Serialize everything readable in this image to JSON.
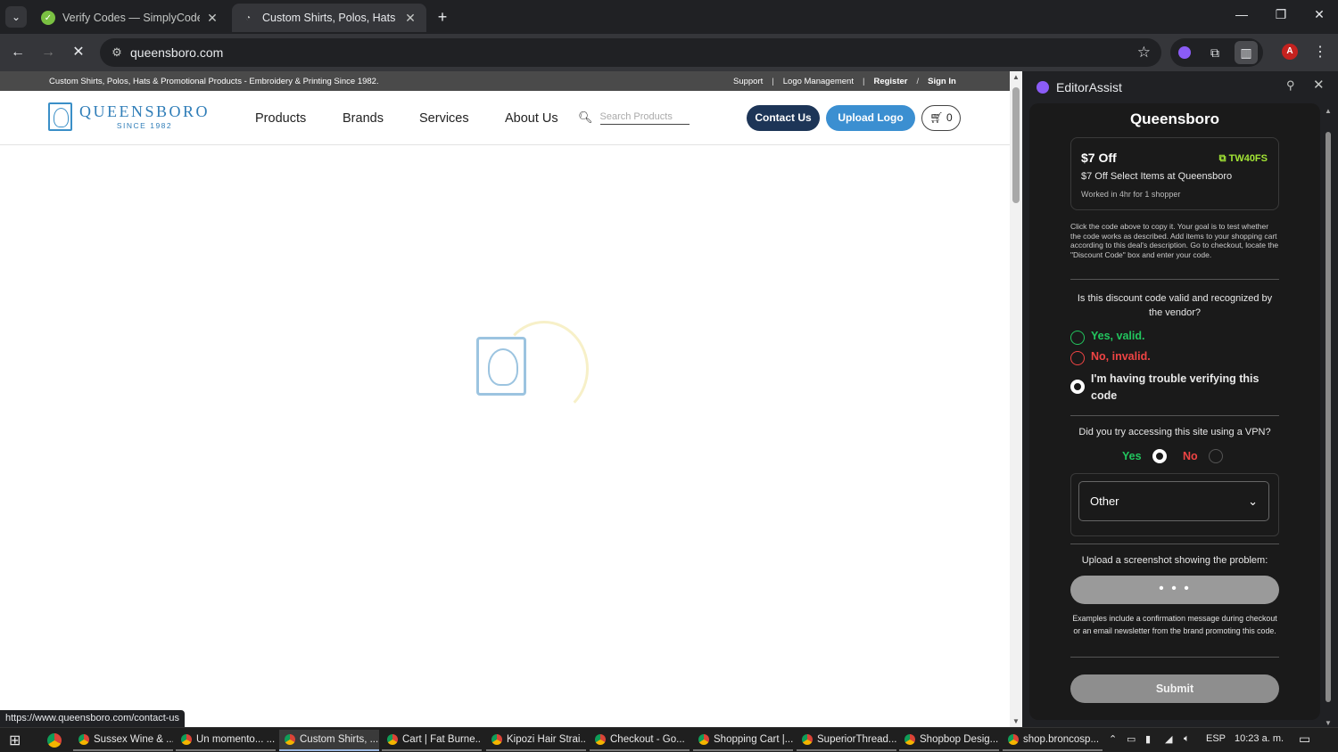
{
  "browser": {
    "tabs": [
      {
        "title": "Verify Codes — SimplyCodes",
        "active": false
      },
      {
        "title": "Custom Shirts, Polos, Hats & Pr",
        "active": true
      }
    ],
    "url": "queensboro.com",
    "status_url": "https://www.queensboro.com/contact-us",
    "profile_initial": "A"
  },
  "site": {
    "tagline": "Custom Shirts, Polos, Hats & Promotional Products - Embroidery & Printing Since 1982.",
    "top_links": [
      "Support",
      "Logo Management",
      "Register",
      "Sign In"
    ],
    "logo": {
      "name": "QUEENSBORO",
      "since": "SINCE 1982"
    },
    "nav": [
      "Products",
      "Brands",
      "Services",
      "About Us"
    ],
    "search_placeholder": "Search Products",
    "contact_label": "Contact Us",
    "upload_label": "Upload Logo",
    "cart_count": "0",
    "colors": {
      "navy": "#1d3557",
      "blue": "#3b8fd1",
      "brand": "#2f7db8"
    }
  },
  "panel": {
    "title": "EditorAssist",
    "store": "Queensboro",
    "deal": {
      "amount": "$7 Off",
      "code": "TW40FS",
      "description": "$7 Off Select Items at Queensboro",
      "worked": "Worked in 4hr for 1 shopper"
    },
    "instructions": "Click the code above to copy it. Your goal is to test whether the code works as described. Add items to your shopping cart according to this deal's description. Go to checkout, locate the \"Discount Code\" box and enter your code.",
    "question_valid": "Is this discount code valid and recognized by the vendor?",
    "options": [
      {
        "label": "Yes, valid.",
        "color": "#22c55e",
        "selected": false
      },
      {
        "label": "No, invalid.",
        "color": "#ef4444",
        "selected": false
      },
      {
        "label": "I'm having trouble verifying this code",
        "color": "#e8e8e8",
        "selected": true
      }
    ],
    "question_vpn": "Did you try accessing this site using a VPN?",
    "vpn_yes": "Yes",
    "vpn_no": "No",
    "vpn_selected": "Yes",
    "reason_select": "Other",
    "upload_prompt": "Upload a screenshot showing the problem:",
    "upload_button": "• • •",
    "examples": "Examples include a confirmation message during checkout or an email newsletter from the brand promoting this code.",
    "submit": "Submit"
  },
  "taskbar": {
    "items": [
      "Sussex Wine & ...",
      "Un momento... ...",
      "Custom Shirts, ...",
      "Cart | Fat Burne...",
      "Kipozi Hair Strai...",
      "Checkout - Go...",
      "Shopping Cart |...",
      "SuperiorThread...",
      "Shopbop Desig...",
      "shop.broncosp..."
    ],
    "active_index": 2,
    "language": "ESP",
    "clock": "10:23 a. m."
  }
}
